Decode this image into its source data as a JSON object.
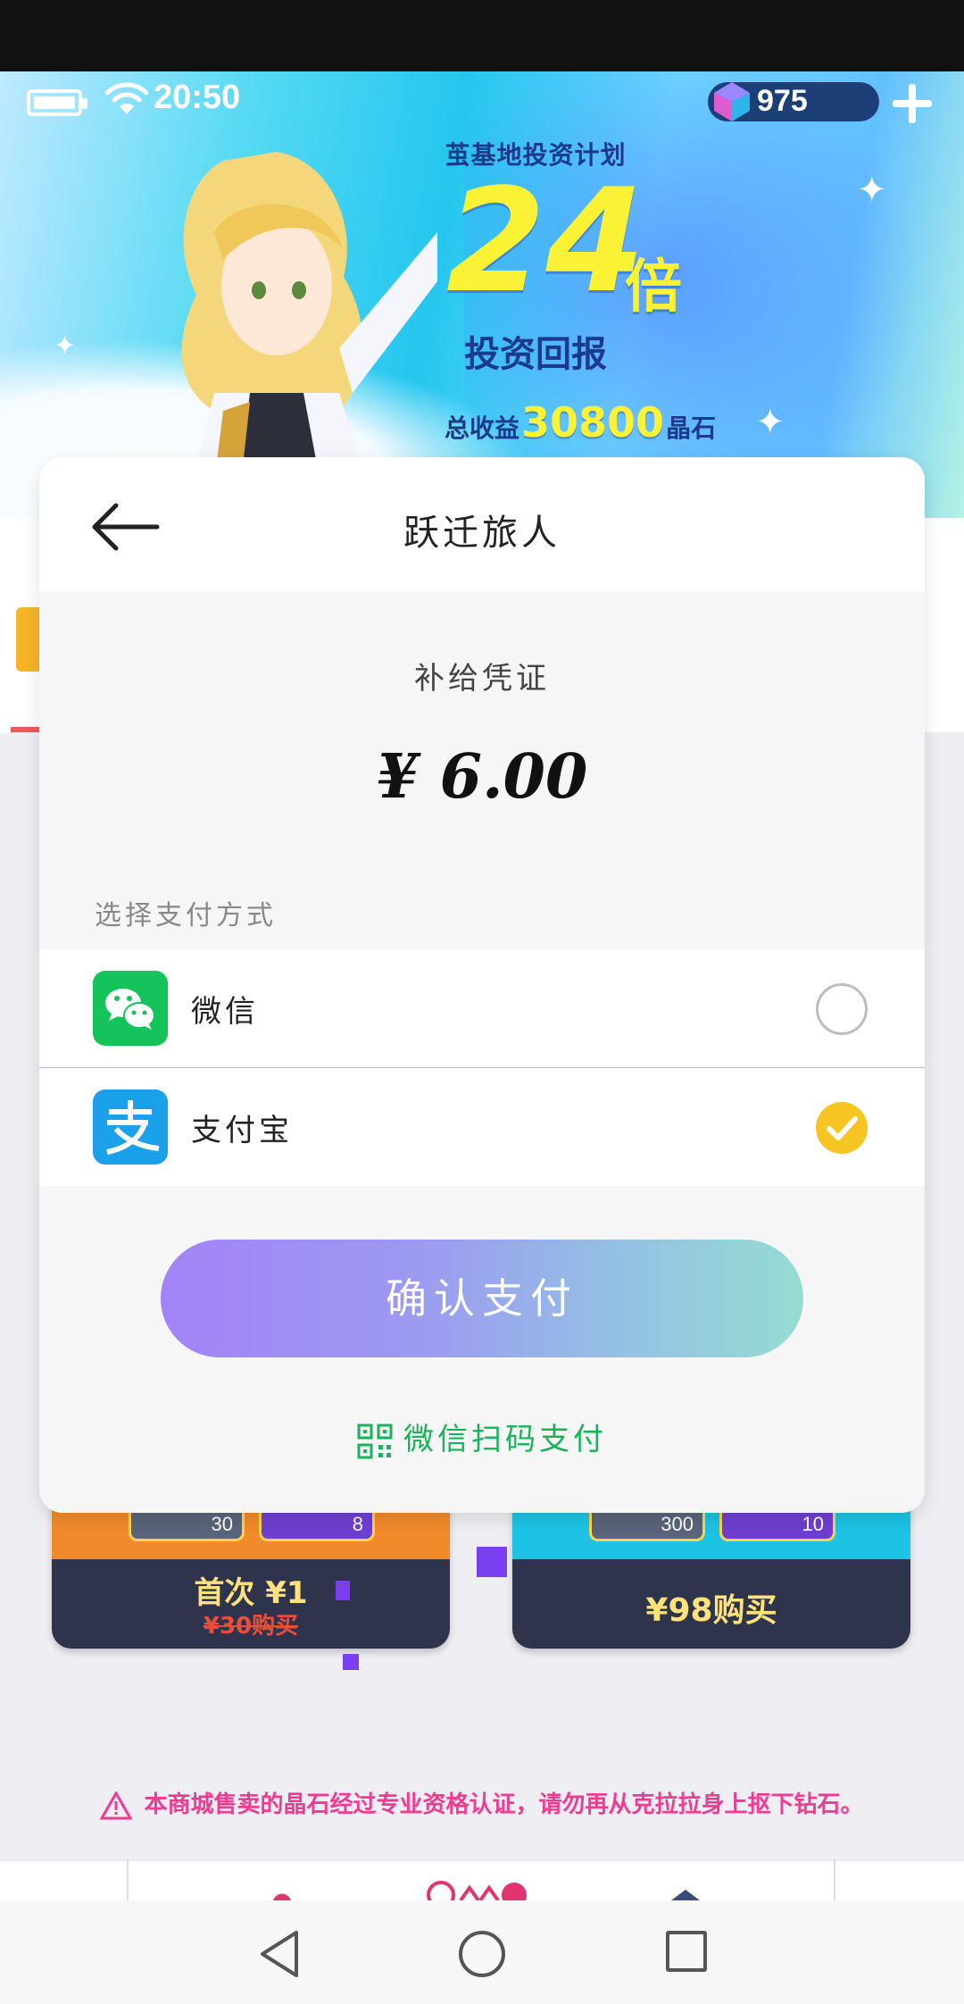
{
  "status_bar": {
    "time": "20:50"
  },
  "currency": {
    "count": "975"
  },
  "banner": {
    "subtitle": "茧基地投资计划",
    "multiplier": "24",
    "multiplier_unit": "倍",
    "return_text": "投资回报",
    "total_label": "总收益",
    "total_value": "30800",
    "total_unit": "晶石"
  },
  "payment_sheet": {
    "title": "跃迁旅人",
    "product_name": "补给凭证",
    "amount": "¥ 6.00",
    "method_label": "选择支付方式",
    "methods": [
      {
        "name": "微信",
        "icon": "wechat-icon",
        "selected": false
      },
      {
        "name": "支付宝",
        "icon": "alipay-icon",
        "selected": true
      }
    ],
    "confirm_label": "确认支付",
    "qr_label": "微信扫码支付"
  },
  "shop_cards": [
    {
      "chip_a": "30",
      "chip_b": "8",
      "price": "首次 ¥1",
      "old_price": "¥30购买"
    },
    {
      "chip_a": "300",
      "chip_b": "10",
      "price": "¥98购买"
    }
  ],
  "warning": "本商城售卖的晶石经过专业资格认证，请勿再从克拉拉身上抠下钻石。",
  "colors": {
    "accent_yellow": "#fbf236",
    "wechat_green": "#14c45a",
    "alipay_blue": "#1ba1ea",
    "selected_radio": "#f7c522",
    "warning_pink": "#ef3c91"
  }
}
